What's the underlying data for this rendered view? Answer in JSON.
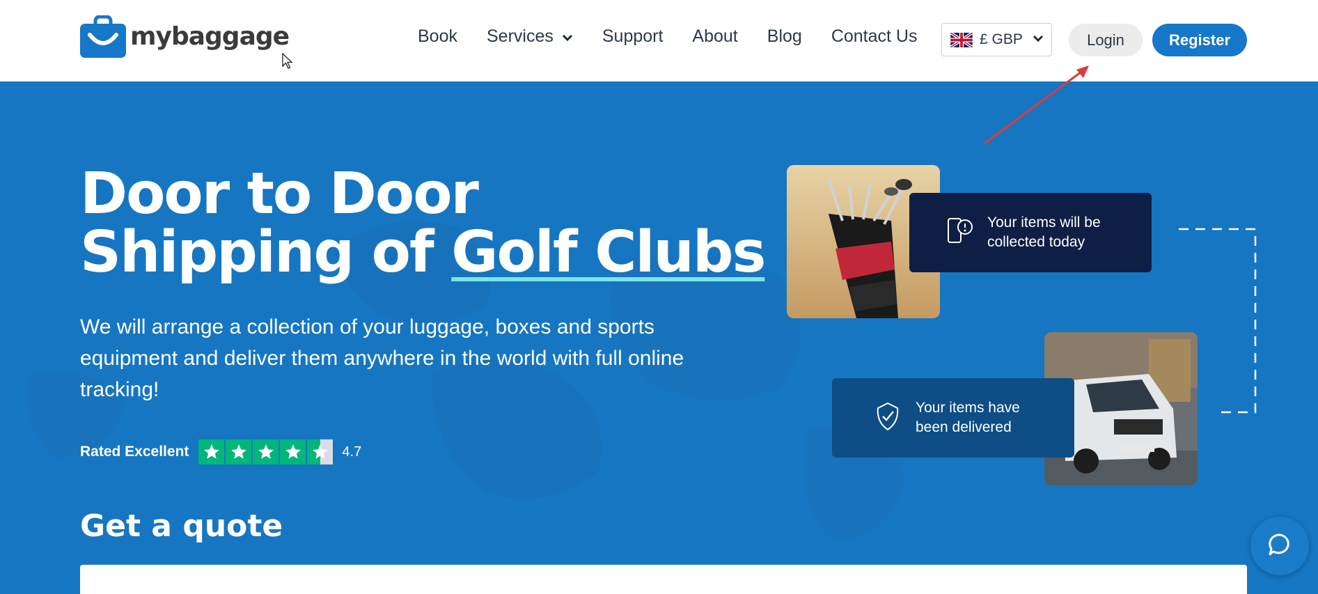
{
  "header": {
    "logo_text": "mybaggage",
    "nav": [
      {
        "label": "Book"
      },
      {
        "label": "Services"
      },
      {
        "label": "Support"
      },
      {
        "label": "About"
      },
      {
        "label": "Blog"
      },
      {
        "label": "Contact Us"
      }
    ],
    "currency": {
      "selected": "£ GBP",
      "flag_icon": "uk-flag-icon"
    },
    "login_label": "Login",
    "register_label": "Register"
  },
  "hero": {
    "title_line1": "Door to Door",
    "title_line2_prefix": "Shipping of ",
    "title_highlight": "Golf Clubs",
    "subtitle": "We will arrange a collection of your luggage, boxes and sports equipment and deliver them anywhere in the world with full online tracking!",
    "rating": {
      "label": "Rated Excellent",
      "score": "4.7",
      "stars": 4.5
    },
    "quote_title": "Get a quote"
  },
  "status_cards": {
    "collect_line1": "Your items will be",
    "collect_line2": "collected today",
    "deliver_line1": "Your items have",
    "deliver_line2": "been delivered"
  },
  "colors": {
    "brand_blue": "#1777c9",
    "hero_bg": "#1676c2",
    "highlight_underline": "#7de3e8",
    "trustpilot_green": "#00b67a",
    "annotation_red": "#e03a3a"
  }
}
